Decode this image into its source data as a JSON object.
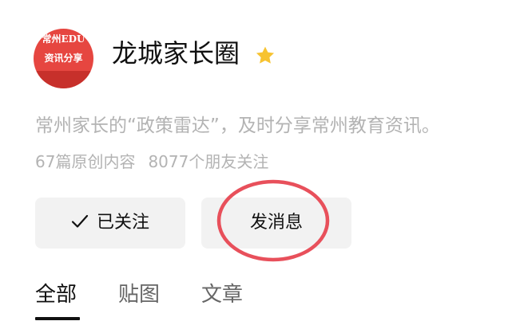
{
  "profile": {
    "avatar_line1": "常州EDU",
    "avatar_line2": "资讯分享",
    "name": "龙城家长圈",
    "star_icon": "star-icon",
    "star_color": "#f7c331",
    "description": "常州家长的“政策雷达”，及时分享常州教育资讯。",
    "original_count": "67篇原创内容",
    "followers": "8077个朋友关注"
  },
  "actions": {
    "follow_label": "已关注",
    "follow_icon": "check-icon",
    "message_label": "发消息"
  },
  "annotation": {
    "shape": "ellipse",
    "color": "#e8505b",
    "target": "message-button"
  },
  "tabs": [
    {
      "label": "全部",
      "active": true
    },
    {
      "label": "贴图",
      "active": false
    },
    {
      "label": "文章",
      "active": false
    }
  ],
  "colors": {
    "avatar_bg": "#e64640",
    "button_bg": "#f2f2f2",
    "muted_text": "#b3b3b3"
  }
}
